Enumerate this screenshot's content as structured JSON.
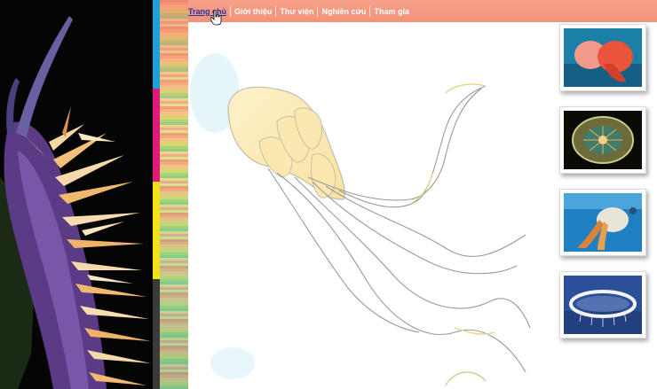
{
  "nav": {
    "items": [
      {
        "label": "Trang chủ",
        "active": true
      },
      {
        "label": "Giới thiệu",
        "active": false
      },
      {
        "label": "Thư viện",
        "active": false
      },
      {
        "label": "Nghiên cứu",
        "active": false
      },
      {
        "label": "Tham gia",
        "active": false
      }
    ]
  },
  "colors": {
    "nav_background": "#f19378",
    "active_link": "#2233aa",
    "stripe": [
      "#1ea0d8",
      "#e0197a",
      "#f2e21a",
      "#3a3a3a"
    ]
  },
  "thumbnails": [
    {
      "subject": "orange-jellyfish"
    },
    {
      "subject": "translucent-round-jellyfish"
    },
    {
      "subject": "lions-mane-jellyfish"
    },
    {
      "subject": "ring-jellyfish"
    }
  ]
}
